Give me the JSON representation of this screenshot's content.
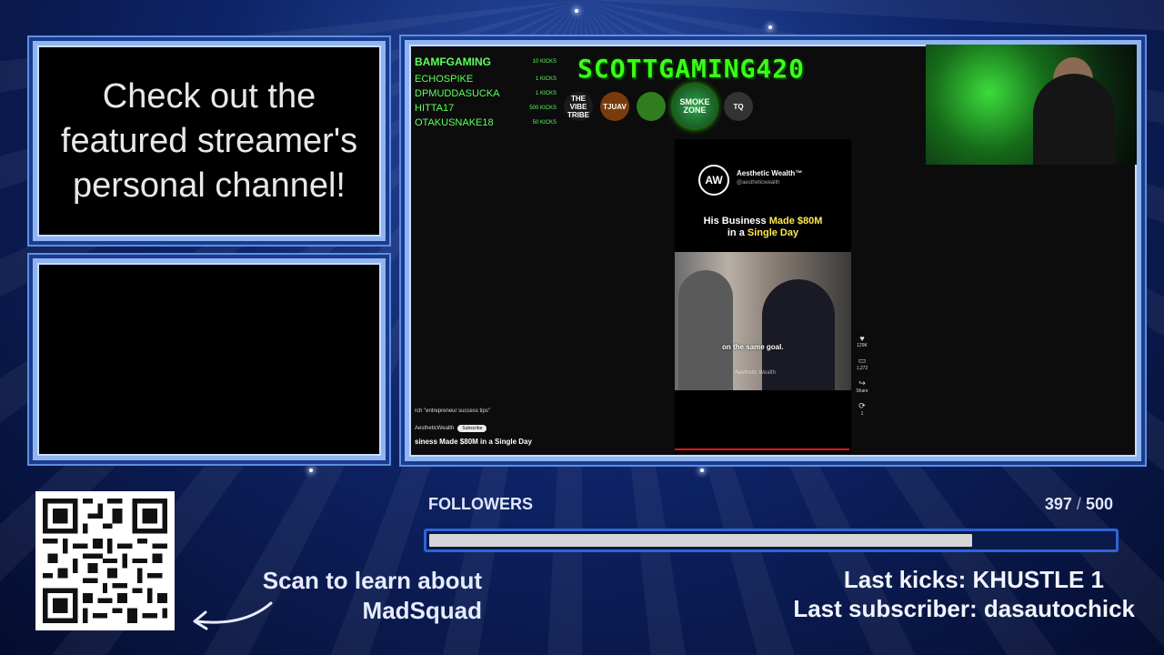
{
  "promo": {
    "text": "Check out the featured streamer's personal channel!"
  },
  "stream_overlay": {
    "kick_list": [
      {
        "name": "BAMFGAMING",
        "amount": "10 KICKS"
      },
      {
        "name": "ECHOSPIKE",
        "amount": "1 KICKS"
      },
      {
        "name": "DPMUDDASUCKA",
        "amount": "1 KICKS"
      },
      {
        "name": "HITTA17",
        "amount": "500 KICKS"
      },
      {
        "name": "OTAKUSNAKE18",
        "amount": "50 KICKS"
      }
    ],
    "banner_title": "SCOTTGAMING420",
    "logos": [
      {
        "name": "the-vibe-tribe-logo",
        "text": "THE VIBE TRIBE",
        "color": "#1a1a1a"
      },
      {
        "name": "tjuav-logo",
        "text": "TJUAV",
        "color": "#7a3b0c"
      },
      {
        "name": "green-team-logo",
        "text": "",
        "color": "#2f7d1f"
      },
      {
        "name": "smoke-zone-logo",
        "text": "SMOKE ZONE",
        "color": "#2b7d3a"
      },
      {
        "name": "tq-logo",
        "text": "TQ",
        "color": "#333333"
      }
    ],
    "short": {
      "channel_initials": "AW",
      "channel_name": "Aesthetic Wealth™",
      "handle": "@aestheticwealth",
      "headline_start": "His Business ",
      "headline_highlight_1": "Made $80M",
      "headline_mid": " in a ",
      "headline_highlight_2": "Single Day",
      "caption": "on the same goal.",
      "watermark": "Aesthetic Wealth"
    },
    "side_actions": [
      {
        "icon": "heart-icon",
        "glyph": "♥",
        "label": "129K"
      },
      {
        "icon": "comment-icon",
        "glyph": "▭",
        "label": "1,272"
      },
      {
        "icon": "share-icon",
        "glyph": "↪",
        "label": "Share"
      },
      {
        "icon": "remix-icon",
        "glyph": "⟳",
        "label": "1"
      }
    ],
    "search_hint": "rch \"entrepreneur success tips\"",
    "channel_small": "AestheticWealth",
    "subscribe_label": "Subscribe",
    "video_title": "siness Made $80M in a Single Day"
  },
  "qr": {
    "label_line1": "Scan to learn about",
    "label_line2": "MadSquad"
  },
  "followers": {
    "label": "FOLLOWERS",
    "current": "397",
    "separator": "/",
    "goal": "500",
    "progress_fraction": 0.794
  },
  "events": {
    "last_kicks": "Last kicks: KHUSTLE 1",
    "last_subscriber": "Last subscriber: dasautochick"
  },
  "colors": {
    "frame_border": "#8fb5f0",
    "neon_green": "#39ff14",
    "bar_border": "#2f63d8",
    "bar_fill": "#d6d6d6"
  }
}
